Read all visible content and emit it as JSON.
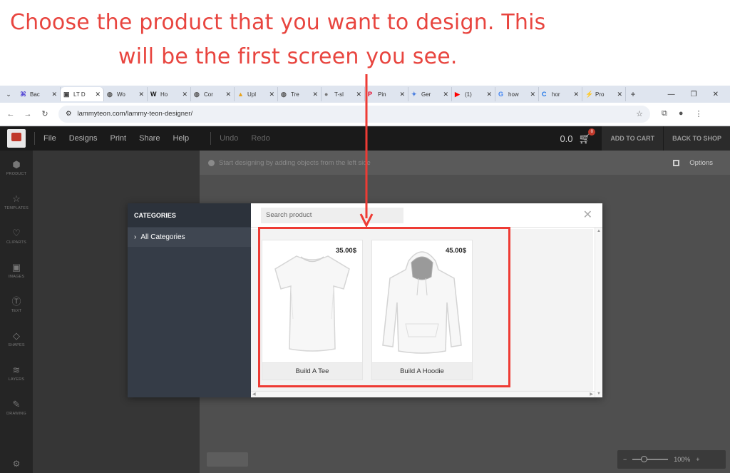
{
  "annotation": {
    "line1": "Choose the product  that you want to design. This",
    "line2": "will be the first screen you see."
  },
  "browser": {
    "tabs": [
      {
        "label": "Bac",
        "icon": "hub-icon",
        "color": "#5b4fd6"
      },
      {
        "label": "LT D",
        "icon": "site-icon",
        "color": "#444444",
        "active": true
      },
      {
        "label": "Wo",
        "icon": "globe-icon",
        "color": "#555555"
      },
      {
        "label": "Ho",
        "icon": "w-icon",
        "color": "#111111"
      },
      {
        "label": "Cor",
        "icon": "globe-icon",
        "color": "#555555"
      },
      {
        "label": "Upl",
        "icon": "upload-icon",
        "color": "#e7a21b"
      },
      {
        "label": "Tre",
        "icon": "globe-icon",
        "color": "#555555"
      },
      {
        "label": "T-sl",
        "icon": "circle-icon",
        "color": "#777777"
      },
      {
        "label": "Pin",
        "icon": "pinterest-icon",
        "color": "#e60023"
      },
      {
        "label": "Ger",
        "icon": "sparkle-icon",
        "color": "#4a7fe0"
      },
      {
        "label": "(1)",
        "icon": "youtube-icon",
        "color": "#ff0000"
      },
      {
        "label": "how",
        "icon": "google-icon",
        "color": "#4285f4"
      },
      {
        "label": "hor",
        "icon": "c-icon",
        "color": "#1a73e8"
      },
      {
        "label": "Pro",
        "icon": "bolt-icon",
        "color": "#22a34a"
      }
    ],
    "url": "lammyteon.com/lammy-teon-designer/"
  },
  "app": {
    "menu": [
      "File",
      "Designs",
      "Print",
      "Share",
      "Help"
    ],
    "undo": "Undo",
    "redo": "Redo",
    "total": "0.0",
    "cart_count": "0",
    "add_to_cart": "ADD TO CART",
    "back_to_shop": "BACK TO SHOP",
    "info": "Start designing by adding objects from the left side",
    "options": "Options",
    "zoom": "100%",
    "sidebar": [
      "PRODUCT",
      "TEMPLATES",
      "CLIPARTS",
      "IMAGES",
      "TEXT",
      "SHAPES",
      "LAYERS",
      "DRAWING"
    ]
  },
  "modal": {
    "categories_title": "CATEGORIES",
    "category_item": "All Categories",
    "search_placeholder": "Search product",
    "products": [
      {
        "name": "Build A Tee",
        "price": "35.00$"
      },
      {
        "name": "Build A Hoodie",
        "price": "45.00$"
      }
    ]
  },
  "colors": {
    "annotation_red": "#ee3b34",
    "category_panel": "#353c47",
    "topbar": "#1a1a1a"
  }
}
